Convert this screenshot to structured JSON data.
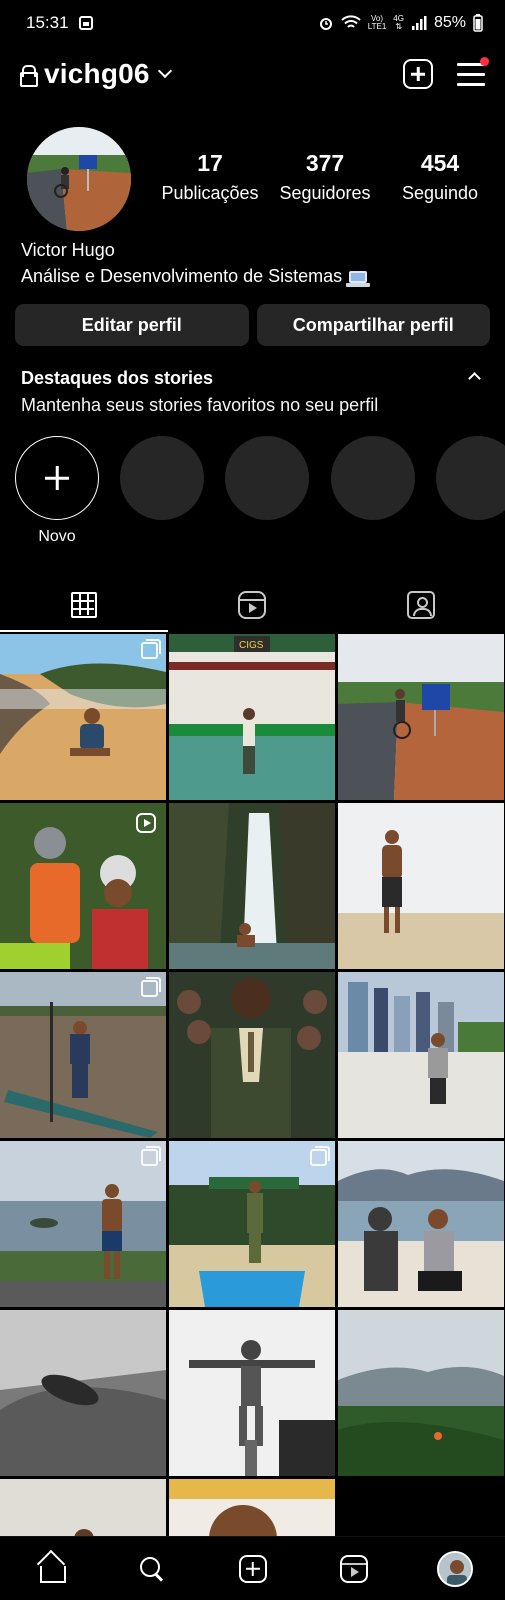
{
  "status_bar": {
    "time": "15:31",
    "network_label_top": "Vo)",
    "network_label_bottom": "LTE1",
    "signal_label_top": "4G",
    "battery": "85%"
  },
  "header": {
    "username": "vichg06",
    "notification_color": "#ff3040"
  },
  "profile": {
    "stats": [
      {
        "value": "17",
        "label": "Publicações"
      },
      {
        "value": "377",
        "label": "Seguidores"
      },
      {
        "value": "454",
        "label": "Seguindo"
      }
    ],
    "name": "Victor Hugo",
    "bio": "Análise e Desenvolvimento de Sistemas"
  },
  "buttons": {
    "edit": "Editar perfil",
    "share": "Compartilhar perfil"
  },
  "highlights": {
    "title": "Destaques dos stories",
    "subtitle": "Mantenha seus stories favoritos no seu perfil",
    "new_label": "Novo"
  },
  "tabs": [
    {
      "icon": "grid-icon",
      "active": true
    },
    {
      "icon": "reels-icon",
      "active": false
    },
    {
      "icon": "tagged-icon",
      "active": false
    }
  ],
  "bottom_nav": [
    "home-icon",
    "search-icon",
    "create-icon",
    "reels-icon",
    "profile-avatar"
  ]
}
